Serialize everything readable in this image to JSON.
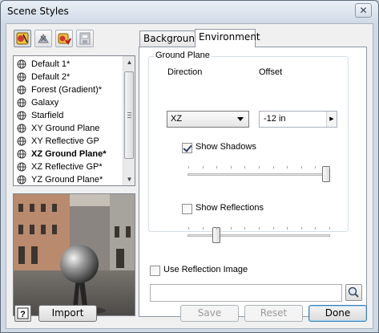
{
  "window": {
    "title": "Scene Styles",
    "close_glyph": "✕"
  },
  "toolbar": {
    "buttons": [
      {
        "icon": "new-style-icon",
        "active": true
      },
      {
        "icon": "purge-style-icon",
        "active": false
      },
      {
        "icon": "activate-style-icon",
        "active": false
      },
      {
        "icon": "save-to-library-icon",
        "active": false
      }
    ]
  },
  "style_list": {
    "items": [
      {
        "label": "Default 1*",
        "bold": false
      },
      {
        "label": "Default 2*",
        "bold": false
      },
      {
        "label": "Forest (Gradient)*",
        "bold": false
      },
      {
        "label": "Galaxy",
        "bold": false
      },
      {
        "label": "Starfield",
        "bold": false
      },
      {
        "label": "XY Ground Plane",
        "bold": false
      },
      {
        "label": "XY Reflective GP",
        "bold": false
      },
      {
        "label": "XZ Ground Plane*",
        "bold": true
      },
      {
        "label": "XZ Reflective GP*",
        "bold": false
      },
      {
        "label": "YZ Ground Plane*",
        "bold": false
      }
    ]
  },
  "tabs": [
    {
      "label": "Background",
      "active": false
    },
    {
      "label": "Environment",
      "active": true
    }
  ],
  "ground_plane": {
    "group_title": "Ground Plane",
    "direction_label": "Direction",
    "direction_value": "XZ",
    "offset_label": "Offset",
    "offset_value": "-12 in",
    "show_shadows_label": "Show Shadows",
    "show_shadows_checked": true,
    "shadow_slider_level": 1.0,
    "show_reflections_label": "Show Reflections",
    "show_reflections_checked": false,
    "reflection_slider_level": 0.2
  },
  "reflection_image": {
    "checkbox_label": "Use Reflection Image",
    "checked": false,
    "path_value": ""
  },
  "footer": {
    "help_glyph": "?",
    "import_label": "Import",
    "save_label": "Save",
    "reset_label": "Reset",
    "done_label": "Done"
  }
}
